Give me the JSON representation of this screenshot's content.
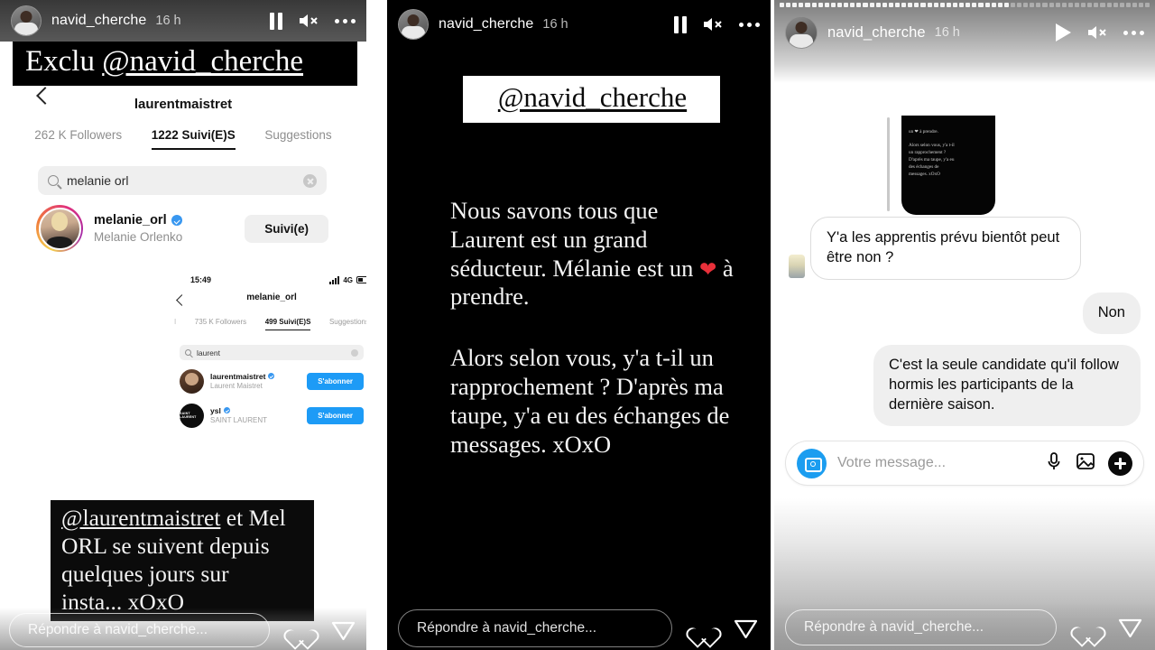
{
  "panel1": {
    "header": {
      "username": "navid_cherche",
      "time": "16 h",
      "pause_icon": "pause-icon",
      "mute_icon": "mute-icon",
      "more_icon": "more-options-icon"
    },
    "banner": {
      "prefix": "Exclu ",
      "handle": "@navid_cherche"
    },
    "instagram": {
      "back_icon": "back-chevron-icon",
      "title": "laurentmaistret",
      "tabs": [
        {
          "label": "262 K Followers",
          "active": false
        },
        {
          "label": "1222 Suivi(E)S",
          "active": true
        },
        {
          "label": "Suggestions",
          "active": false
        }
      ],
      "search": {
        "icon": "search-icon",
        "value": "melanie orl",
        "clear_icon": "clear-icon"
      },
      "result": {
        "username": "melanie_orl",
        "verified_icon": "verified-badge-icon",
        "fullname": "Melanie Orlenko",
        "follow_label": "Suivi(e)",
        "avatar": "profile-avatar"
      }
    },
    "inner_screenshot": {
      "status": {
        "time": "15:49",
        "network": "4G",
        "signal_icon": "signal-bars-icon",
        "battery_icon": "battery-icon"
      },
      "back_icon": "back-chevron-icon",
      "title": "melanie_orl",
      "tabs": [
        {
          "label": "735 K Followers",
          "active": false
        },
        {
          "label": "499 Suivi(E)S",
          "active": true
        },
        {
          "label": "Suggestions",
          "active": false
        }
      ],
      "search": {
        "icon": "search-icon",
        "value": "laurent",
        "clear_icon": "clear-icon"
      },
      "rows": [
        {
          "username": "laurentmaistret",
          "fullname": "Laurent Maistret",
          "button": "S'abonner",
          "avatar_text": ""
        },
        {
          "username": "ysl",
          "fullname": "SAINT LAURENT",
          "button": "S'abonner",
          "avatar_text": "SAINT LAURENT"
        }
      ]
    },
    "caption": {
      "line1_handle": "@laurentmaistret",
      "line1_rest": " et Mel",
      "line2": "ORL se suivent depuis",
      "line3": "quelques jours sur",
      "line4": "insta... xOxO"
    },
    "reply": {
      "placeholder": "Répondre à navid_cherche...",
      "like_icon": "heart-icon",
      "share_icon": "send-icon"
    }
  },
  "panel2": {
    "header": {
      "username": "navid_cherche",
      "time": "16 h",
      "pause_icon": "pause-icon",
      "mute_icon": "mute-icon",
      "more_icon": "more-options-icon"
    },
    "title_box": "@navid_cherche",
    "para1_a": "Nous savons tous que Laurent est un grand séducteur. Mélanie est un ",
    "para1_heart": "❤",
    "para1_b": " à prendre.",
    "para2": "Alors selon vous, y'a t-il un rapprochement ? D'après ma taupe, y'a eu des échanges de messages. xOxO",
    "reply": {
      "placeholder": "Répondre à navid_cherche...",
      "like_icon": "heart-icon",
      "share_icon": "send-icon"
    }
  },
  "panel3": {
    "progress": {
      "segments": 58,
      "filled": 36
    },
    "header": {
      "username": "navid_cherche",
      "time": "16 h",
      "play_icon": "play-icon",
      "mute_icon": "mute-icon",
      "more_icon": "more-options-icon"
    },
    "quoted_story": {
      "l1": "un ❤ à prendre.",
      "l2": "Alors selon vous, y'a t-il",
      "l3": "un rapprochement ?",
      "l4": "D'après ma taupe, y'a eu",
      "l5": "des échanges de",
      "l6": "messages. xOxO"
    },
    "messages": [
      {
        "side": "left",
        "style": "them",
        "text": "Y'a les apprentis prévu bientôt peut être non ?"
      },
      {
        "side": "right",
        "style": "grey",
        "text": "Non"
      },
      {
        "side": "right",
        "style": "grey",
        "text": "C'est la seule candidate qu'il follow hormis les participants de la dernière saison."
      }
    ],
    "input": {
      "camera_icon": "camera-icon",
      "placeholder": "Votre message...",
      "mic_icon": "microphone-icon",
      "gallery_icon": "image-icon",
      "plus_icon": "plus-icon"
    },
    "reply": {
      "placeholder": "Répondre à navid_cherche...",
      "like_icon": "heart-icon",
      "share_icon": "send-icon"
    }
  }
}
